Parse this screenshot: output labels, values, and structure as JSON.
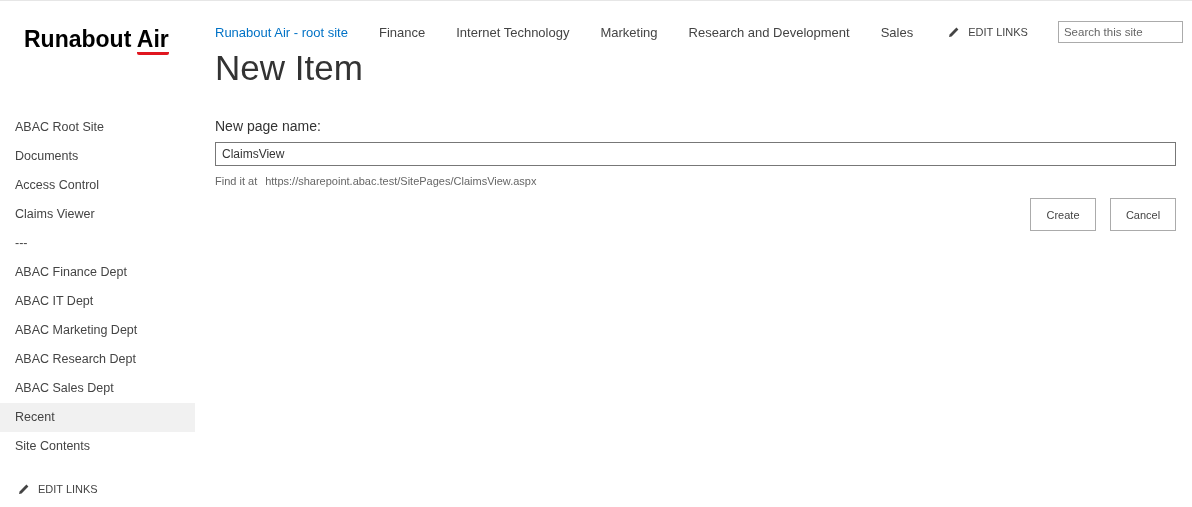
{
  "logo": {
    "main": "Runabout",
    "accent": "Air"
  },
  "top_nav": [
    {
      "label": "Runabout Air - root site",
      "selected": true
    },
    {
      "label": "Finance",
      "selected": false
    },
    {
      "label": "Internet Technology",
      "selected": false
    },
    {
      "label": "Marketing",
      "selected": false
    },
    {
      "label": "Research and Development",
      "selected": false
    },
    {
      "label": "Sales",
      "selected": false
    }
  ],
  "top_edit_links": "EDIT LINKS",
  "search": {
    "placeholder": "Search this site"
  },
  "page_title": "New Item",
  "sidebar": {
    "items": [
      {
        "label": "ABAC Root Site",
        "selected": false
      },
      {
        "label": "Documents",
        "selected": false
      },
      {
        "label": "Access Control",
        "selected": false
      },
      {
        "label": "Claims Viewer",
        "selected": false
      },
      {
        "label": "---",
        "selected": false
      },
      {
        "label": "ABAC Finance Dept",
        "selected": false
      },
      {
        "label": "ABAC IT Dept",
        "selected": false
      },
      {
        "label": "ABAC Marketing Dept",
        "selected": false
      },
      {
        "label": "ABAC Research Dept",
        "selected": false
      },
      {
        "label": "ABAC Sales Dept",
        "selected": false
      },
      {
        "label": "Recent",
        "selected": true
      },
      {
        "label": "Site Contents",
        "selected": false
      }
    ],
    "edit_links": "EDIT LINKS"
  },
  "form": {
    "label": "New page name:",
    "value": "ClaimsView",
    "hint_label": "Find it at",
    "hint_url": "https://sharepoint.abac.test/SitePages/ClaimsView.aspx",
    "buttons": [
      "Create",
      "Cancel"
    ]
  }
}
